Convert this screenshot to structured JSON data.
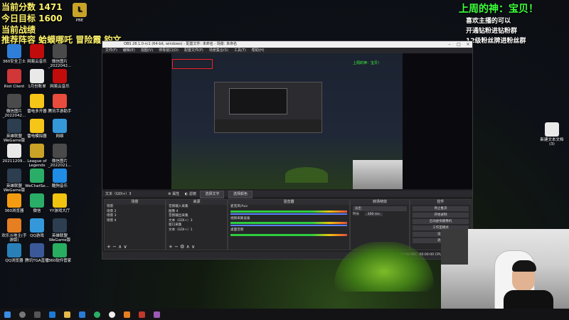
{
  "overlay": {
    "score_line": "当前分数 1471",
    "goal_line": "今日目标 1600",
    "battle_line": "当前战绩",
    "recommend_line": "推荐阵容 蛤蟆哪吒 冒险霞 钓文",
    "god_title": "上周的神：宝贝！",
    "fan_line1": "喜欢主播的可以",
    "fan_line2": "开通钻粉进钻粉群",
    "fan_line3": "12级粉丝牌进粉丝群"
  },
  "desktop_icons_left": [
    {
      "label": "360安全卫士",
      "color": "#2f7ed8",
      "icon": "shield-icon"
    },
    {
      "label": "网易云音乐",
      "color": "#c20c0c",
      "icon": "music-icon"
    },
    {
      "label": "微信图片_2022042...",
      "color": "#4a4a4a",
      "icon": "image-icon"
    },
    {
      "label": "Riot Client",
      "color": "#d13639",
      "icon": "riot-icon"
    },
    {
      "label": "1月份账单",
      "color": "#e9e9e9",
      "icon": "document-icon"
    },
    {
      "label": "网易云音乐",
      "color": "#c20c0c",
      "icon": "music-icon"
    },
    {
      "label": "微信图片_2022042...",
      "color": "#4a4a4a",
      "icon": "image-icon"
    },
    {
      "label": "雷电多开器",
      "color": "#f5c518",
      "icon": "thunder-icon"
    },
    {
      "label": "腾讯手游助手",
      "color": "#e74c3c",
      "icon": "game-icon"
    },
    {
      "label": "英雄联盟WeGame版",
      "color": "#2c3e50",
      "icon": "lol-icon"
    },
    {
      "label": "雷电模拟器",
      "color": "#f5c518",
      "icon": "thunder-icon"
    },
    {
      "label": "网络",
      "color": "#3498db",
      "icon": "network-icon"
    },
    {
      "label": "20211209...",
      "color": "#e9e9e9",
      "icon": "document-icon"
    },
    {
      "label": "League of Legends",
      "color": "#c9a227",
      "icon": "lol-icon"
    },
    {
      "label": "微信图片_2022021...",
      "color": "#4a4a4a",
      "icon": "image-icon"
    },
    {
      "label": "英雄联盟WeGame版",
      "color": "#2c3e50",
      "icon": "lol-icon"
    },
    {
      "label": "WeChatSe...",
      "color": "#2aae67",
      "icon": "wechat-icon"
    },
    {
      "label": "酷狗音乐",
      "color": "#1f8ce6",
      "icon": "kugou-icon"
    },
    {
      "label": "360浏览器",
      "color": "#f39c12",
      "icon": "browser-icon"
    },
    {
      "label": "微信",
      "color": "#2aae67",
      "icon": "wechat-icon"
    },
    {
      "label": "YY游戏大厅",
      "color": "#f1c40f",
      "icon": "yy-icon"
    },
    {
      "label": "欢乐斗地主(手游版)",
      "color": "#e67e22",
      "icon": "cards-icon"
    },
    {
      "label": "QQ游戏",
      "color": "#3498db",
      "icon": "qq-icon"
    },
    {
      "label": "英雄联盟WeGame版",
      "color": "#2c3e50",
      "icon": "lol-icon"
    },
    {
      "label": "QQ浏览器",
      "color": "#2980b9",
      "icon": "browser-icon"
    },
    {
      "label": "腾讯TGA直播",
      "color": "#3b5998",
      "icon": "tga-icon"
    },
    {
      "label": "360软件管家",
      "color": "#27ae60",
      "icon": "software-icon"
    }
  ],
  "desktop_icons_right": [
    {
      "label": "新建文本文档(3)",
      "color": "#e9e9e9",
      "icon": "document-icon"
    }
  ],
  "top_icon": {
    "label": "PBE",
    "color": "#c9a227",
    "icon": "lol-icon"
  },
  "obs": {
    "title": "OBS 28.1.0-rc1 (64-bit, windows) - 配置文件: 未命名 - 场景: 未命名",
    "menu": [
      "文件(F)",
      "编辑(E)",
      "视图(V)",
      "停靠窗口(D)",
      "配置文件(P)",
      "场景集合(S)",
      "工具(T)",
      "帮助(H)"
    ],
    "scene_label": "文本（GDI+）3",
    "props_btn": "属性",
    "filters_btn": "滤镜",
    "select_text_btn": "选择文字",
    "source_btn": "选择颜色",
    "docks": {
      "scenes": {
        "title": "场景",
        "items": [
          "场景",
          "场景 2",
          "场景 3",
          "场景 4"
        ]
      },
      "sources": {
        "title": "来源",
        "items": [
          "音频输入采集",
          "图像 4",
          "音频输出采集",
          "文本（GDI+）3",
          "窗口采集",
          "文本（GDI+）1",
          "显示器采集 2"
        ]
      },
      "mixer": {
        "title": "混音器",
        "items": [
          "麦克风/Aux",
          "-0.0 dB",
          "视频采集设备",
          "0.0 dB",
          "桌面音频",
          "0.0 dB"
        ]
      },
      "transitions": {
        "title": "转场特效",
        "type": "淡出",
        "duration_label": "时长",
        "duration": "300 ms"
      },
      "controls": {
        "title": "控件",
        "buttons": [
          "停止推流",
          "开始录制",
          "启动虚拟摄像机",
          "工作室模式",
          "设置",
          "退出"
        ]
      }
    },
    "status": "LIVE: 00:00:00   REC: 00:00:00   CPU: 1.1%, 30.00 fps"
  },
  "taskbar_icons": [
    "start-icon",
    "search-icon",
    "taskview-icon",
    "edge-icon",
    "folder-icon",
    "store-icon",
    "wechat-icon",
    "obs-icon",
    "game-icon",
    "ppt-icon",
    "music-icon"
  ]
}
